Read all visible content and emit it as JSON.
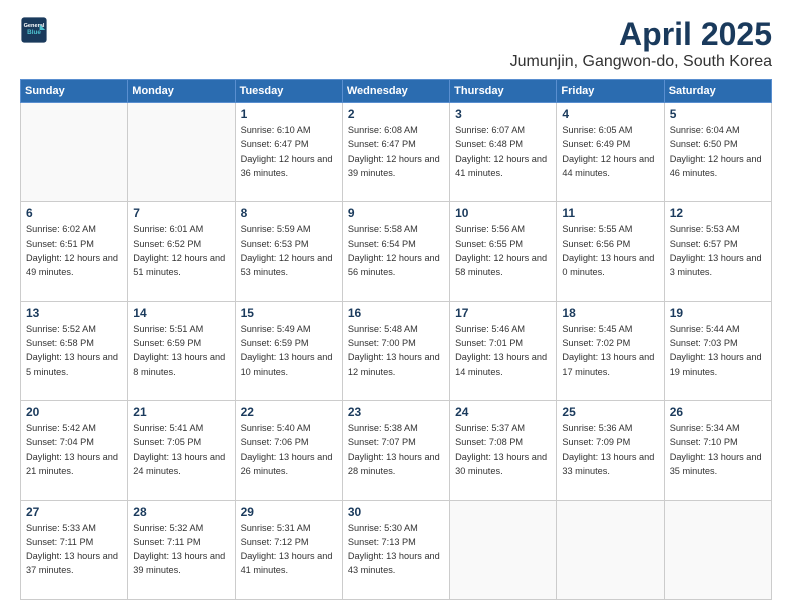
{
  "header": {
    "logo_line1": "General",
    "logo_line2": "Blue",
    "title": "April 2025",
    "subtitle": "Jumunjin, Gangwon-do, South Korea"
  },
  "weekdays": [
    "Sunday",
    "Monday",
    "Tuesday",
    "Wednesday",
    "Thursday",
    "Friday",
    "Saturday"
  ],
  "weeks": [
    [
      {
        "day": "",
        "sunrise": "",
        "sunset": "",
        "daylight": ""
      },
      {
        "day": "",
        "sunrise": "",
        "sunset": "",
        "daylight": ""
      },
      {
        "day": "1",
        "sunrise": "Sunrise: 6:10 AM",
        "sunset": "Sunset: 6:47 PM",
        "daylight": "Daylight: 12 hours and 36 minutes."
      },
      {
        "day": "2",
        "sunrise": "Sunrise: 6:08 AM",
        "sunset": "Sunset: 6:47 PM",
        "daylight": "Daylight: 12 hours and 39 minutes."
      },
      {
        "day": "3",
        "sunrise": "Sunrise: 6:07 AM",
        "sunset": "Sunset: 6:48 PM",
        "daylight": "Daylight: 12 hours and 41 minutes."
      },
      {
        "day": "4",
        "sunrise": "Sunrise: 6:05 AM",
        "sunset": "Sunset: 6:49 PM",
        "daylight": "Daylight: 12 hours and 44 minutes."
      },
      {
        "day": "5",
        "sunrise": "Sunrise: 6:04 AM",
        "sunset": "Sunset: 6:50 PM",
        "daylight": "Daylight: 12 hours and 46 minutes."
      }
    ],
    [
      {
        "day": "6",
        "sunrise": "Sunrise: 6:02 AM",
        "sunset": "Sunset: 6:51 PM",
        "daylight": "Daylight: 12 hours and 49 minutes."
      },
      {
        "day": "7",
        "sunrise": "Sunrise: 6:01 AM",
        "sunset": "Sunset: 6:52 PM",
        "daylight": "Daylight: 12 hours and 51 minutes."
      },
      {
        "day": "8",
        "sunrise": "Sunrise: 5:59 AM",
        "sunset": "Sunset: 6:53 PM",
        "daylight": "Daylight: 12 hours and 53 minutes."
      },
      {
        "day": "9",
        "sunrise": "Sunrise: 5:58 AM",
        "sunset": "Sunset: 6:54 PM",
        "daylight": "Daylight: 12 hours and 56 minutes."
      },
      {
        "day": "10",
        "sunrise": "Sunrise: 5:56 AM",
        "sunset": "Sunset: 6:55 PM",
        "daylight": "Daylight: 12 hours and 58 minutes."
      },
      {
        "day": "11",
        "sunrise": "Sunrise: 5:55 AM",
        "sunset": "Sunset: 6:56 PM",
        "daylight": "Daylight: 13 hours and 0 minutes."
      },
      {
        "day": "12",
        "sunrise": "Sunrise: 5:53 AM",
        "sunset": "Sunset: 6:57 PM",
        "daylight": "Daylight: 13 hours and 3 minutes."
      }
    ],
    [
      {
        "day": "13",
        "sunrise": "Sunrise: 5:52 AM",
        "sunset": "Sunset: 6:58 PM",
        "daylight": "Daylight: 13 hours and 5 minutes."
      },
      {
        "day": "14",
        "sunrise": "Sunrise: 5:51 AM",
        "sunset": "Sunset: 6:59 PM",
        "daylight": "Daylight: 13 hours and 8 minutes."
      },
      {
        "day": "15",
        "sunrise": "Sunrise: 5:49 AM",
        "sunset": "Sunset: 6:59 PM",
        "daylight": "Daylight: 13 hours and 10 minutes."
      },
      {
        "day": "16",
        "sunrise": "Sunrise: 5:48 AM",
        "sunset": "Sunset: 7:00 PM",
        "daylight": "Daylight: 13 hours and 12 minutes."
      },
      {
        "day": "17",
        "sunrise": "Sunrise: 5:46 AM",
        "sunset": "Sunset: 7:01 PM",
        "daylight": "Daylight: 13 hours and 14 minutes."
      },
      {
        "day": "18",
        "sunrise": "Sunrise: 5:45 AM",
        "sunset": "Sunset: 7:02 PM",
        "daylight": "Daylight: 13 hours and 17 minutes."
      },
      {
        "day": "19",
        "sunrise": "Sunrise: 5:44 AM",
        "sunset": "Sunset: 7:03 PM",
        "daylight": "Daylight: 13 hours and 19 minutes."
      }
    ],
    [
      {
        "day": "20",
        "sunrise": "Sunrise: 5:42 AM",
        "sunset": "Sunset: 7:04 PM",
        "daylight": "Daylight: 13 hours and 21 minutes."
      },
      {
        "day": "21",
        "sunrise": "Sunrise: 5:41 AM",
        "sunset": "Sunset: 7:05 PM",
        "daylight": "Daylight: 13 hours and 24 minutes."
      },
      {
        "day": "22",
        "sunrise": "Sunrise: 5:40 AM",
        "sunset": "Sunset: 7:06 PM",
        "daylight": "Daylight: 13 hours and 26 minutes."
      },
      {
        "day": "23",
        "sunrise": "Sunrise: 5:38 AM",
        "sunset": "Sunset: 7:07 PM",
        "daylight": "Daylight: 13 hours and 28 minutes."
      },
      {
        "day": "24",
        "sunrise": "Sunrise: 5:37 AM",
        "sunset": "Sunset: 7:08 PM",
        "daylight": "Daylight: 13 hours and 30 minutes."
      },
      {
        "day": "25",
        "sunrise": "Sunrise: 5:36 AM",
        "sunset": "Sunset: 7:09 PM",
        "daylight": "Daylight: 13 hours and 33 minutes."
      },
      {
        "day": "26",
        "sunrise": "Sunrise: 5:34 AM",
        "sunset": "Sunset: 7:10 PM",
        "daylight": "Daylight: 13 hours and 35 minutes."
      }
    ],
    [
      {
        "day": "27",
        "sunrise": "Sunrise: 5:33 AM",
        "sunset": "Sunset: 7:11 PM",
        "daylight": "Daylight: 13 hours and 37 minutes."
      },
      {
        "day": "28",
        "sunrise": "Sunrise: 5:32 AM",
        "sunset": "Sunset: 7:11 PM",
        "daylight": "Daylight: 13 hours and 39 minutes."
      },
      {
        "day": "29",
        "sunrise": "Sunrise: 5:31 AM",
        "sunset": "Sunset: 7:12 PM",
        "daylight": "Daylight: 13 hours and 41 minutes."
      },
      {
        "day": "30",
        "sunrise": "Sunrise: 5:30 AM",
        "sunset": "Sunset: 7:13 PM",
        "daylight": "Daylight: 13 hours and 43 minutes."
      },
      {
        "day": "",
        "sunrise": "",
        "sunset": "",
        "daylight": ""
      },
      {
        "day": "",
        "sunrise": "",
        "sunset": "",
        "daylight": ""
      },
      {
        "day": "",
        "sunrise": "",
        "sunset": "",
        "daylight": ""
      }
    ]
  ]
}
